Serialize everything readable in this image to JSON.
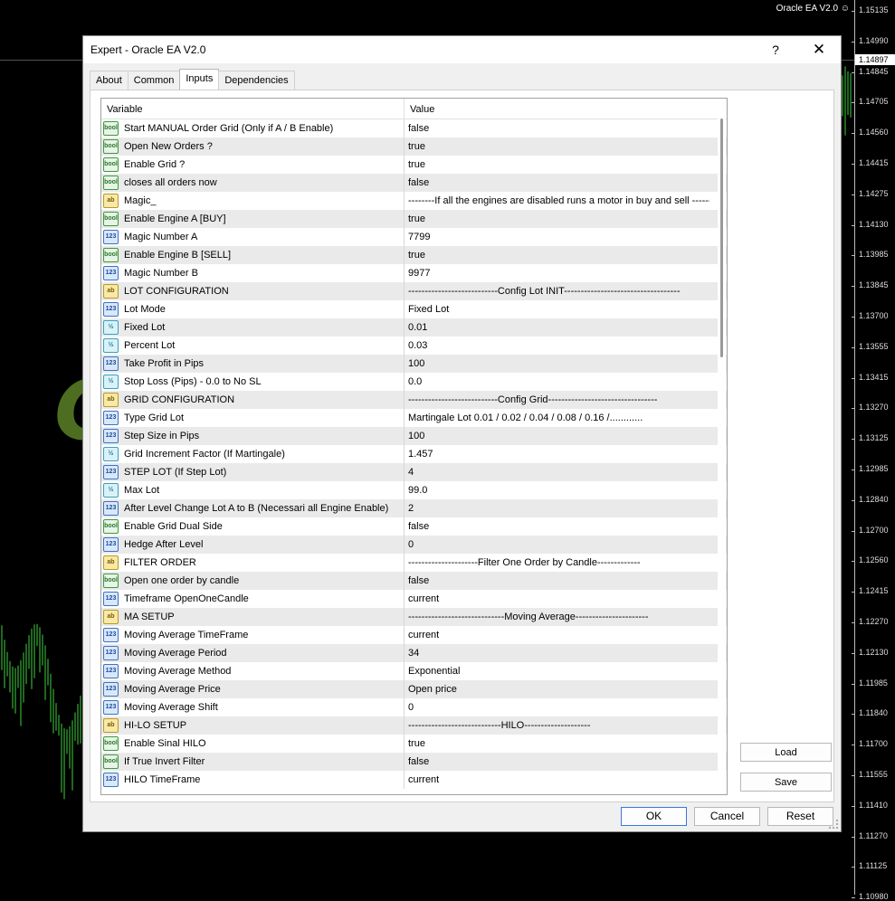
{
  "chart": {
    "ea_tag": "Oracle EA V2.0 ☺",
    "current_price": "1.14897",
    "price_levels": [
      "1.15135",
      "1.14990",
      "1.14845",
      "1.14705",
      "1.14560",
      "1.14415",
      "1.14275",
      "1.14130",
      "1.13985",
      "1.13845",
      "1.13700",
      "1.13555",
      "1.13415",
      "1.13270",
      "1.13125",
      "1.12985",
      "1.12840",
      "1.12700",
      "1.12560",
      "1.12415",
      "1.12270",
      "1.12130",
      "1.11985",
      "1.11840",
      "1.11700",
      "1.11555",
      "1.11410",
      "1.11270",
      "1.11125",
      "1.10980"
    ]
  },
  "dialog": {
    "title": "Expert - Oracle EA V2.0",
    "help": "?",
    "close": "✕",
    "tabs": [
      "About",
      "Common",
      "Inputs",
      "Dependencies"
    ],
    "active_tab": "Inputs",
    "columns": {
      "variable": "Variable",
      "value": "Value"
    },
    "rows": [
      {
        "type": "bool",
        "icon_label": "bool",
        "variable": "Start MANUAL Order  Grid  (Only if A / B Enable)",
        "value": "false"
      },
      {
        "type": "bool",
        "icon_label": "bool",
        "variable": "Open New Orders ?",
        "value": "true"
      },
      {
        "type": "bool",
        "icon_label": "bool",
        "variable": "Enable Grid ?",
        "value": "true"
      },
      {
        "type": "bool",
        "icon_label": "bool",
        "variable": "closes all orders now",
        "value": "false"
      },
      {
        "type": "str",
        "icon_label": "ab",
        "variable": "Magic_",
        "value": "--------If all the engines are disabled runs a motor in buy and sell ---------"
      },
      {
        "type": "bool",
        "icon_label": "bool",
        "variable": "Enable Engine A   [BUY]",
        "value": "true"
      },
      {
        "type": "int",
        "icon_label": "123",
        "variable": "Magic Number  A",
        "value": "7799"
      },
      {
        "type": "bool",
        "icon_label": "bool",
        "variable": "Enable Engine B   [SELL]",
        "value": "true"
      },
      {
        "type": "int",
        "icon_label": "123",
        "variable": "Magic Number  B",
        "value": "9977"
      },
      {
        "type": "str",
        "icon_label": "ab",
        "variable": "LOT CONFIGURATION",
        "value": "---------------------------Config Lot INIT-----------------------------------"
      },
      {
        "type": "int",
        "icon_label": "123",
        "variable": "Lot Mode",
        "value": "Fixed Lot"
      },
      {
        "type": "dbl",
        "icon_label": "½",
        "variable": "Fixed Lot",
        "value": "0.01"
      },
      {
        "type": "dbl",
        "icon_label": "½",
        "variable": "Percent Lot",
        "value": "0.03"
      },
      {
        "type": "int",
        "icon_label": "123",
        "variable": "Take Profit in Pips",
        "value": "100"
      },
      {
        "type": "dbl",
        "icon_label": "½",
        "variable": "Stop Loss (Pips) - 0.0 to No SL",
        "value": "0.0"
      },
      {
        "type": "str",
        "icon_label": "ab",
        "variable": "GRID CONFIGURATION",
        "value": "---------------------------Config Grid---------------------------------"
      },
      {
        "type": "int",
        "icon_label": "123",
        "variable": "Type Grid Lot",
        "value": "Martingale Lot  0.01 / 0.02 / 0.04 / 0.08 / 0.16 /............"
      },
      {
        "type": "int",
        "icon_label": "123",
        "variable": "Step Size in Pips",
        "value": "100"
      },
      {
        "type": "dbl",
        "icon_label": "½",
        "variable": "Grid Increment Factor (If Martingale)",
        "value": "1.457"
      },
      {
        "type": "int",
        "icon_label": "123",
        "variable": "STEP LOT (If  Step Lot)",
        "value": "4"
      },
      {
        "type": "dbl",
        "icon_label": "½",
        "variable": "Max Lot",
        "value": "99.0"
      },
      {
        "type": "int",
        "icon_label": "123",
        "variable": "After Level Change Lot A to B (Necessari all Engine Enable)",
        "value": "2"
      },
      {
        "type": "bool",
        "icon_label": "bool",
        "variable": "Enable Grid Dual Side",
        "value": "false"
      },
      {
        "type": "int",
        "icon_label": "123",
        "variable": "Hedge After Level",
        "value": "0"
      },
      {
        "type": "str",
        "icon_label": "ab",
        "variable": "FILTER ORDER",
        "value": "---------------------Filter One Order by Candle-------------"
      },
      {
        "type": "bool",
        "icon_label": "bool",
        "variable": "Open one order by candle",
        "value": "false"
      },
      {
        "type": "int",
        "icon_label": "123",
        "variable": "Timeframe OpenOneCandle",
        "value": "current"
      },
      {
        "type": "str",
        "icon_label": "ab",
        "variable": "MA SETUP",
        "value": "-----------------------------Moving Average----------------------"
      },
      {
        "type": "int",
        "icon_label": "123",
        "variable": "Moving Average TimeFrame",
        "value": "current"
      },
      {
        "type": "int",
        "icon_label": "123",
        "variable": "Moving Average Period",
        "value": "34"
      },
      {
        "type": "int",
        "icon_label": "123",
        "variable": "Moving Average Method",
        "value": "Exponential"
      },
      {
        "type": "int",
        "icon_label": "123",
        "variable": "Moving Average Price",
        "value": "Open price"
      },
      {
        "type": "int",
        "icon_label": "123",
        "variable": "Moving Average Shift",
        "value": "0"
      },
      {
        "type": "str",
        "icon_label": "ab",
        "variable": "HI-LO SETUP",
        "value": "----------------------------HILO--------------------"
      },
      {
        "type": "bool",
        "icon_label": "bool",
        "variable": "Enable Sinal  HILO",
        "value": "true"
      },
      {
        "type": "bool",
        "icon_label": "bool",
        "variable": "If True Invert Filter",
        "value": "false"
      },
      {
        "type": "int",
        "icon_label": "123",
        "variable": "HILO TimeFrame",
        "value": "current"
      }
    ],
    "side_buttons": {
      "load": "Load",
      "save": "Save"
    },
    "bottom_buttons": {
      "ok": "OK",
      "cancel": "Cancel",
      "reset": "Reset"
    }
  },
  "watermark": "CheapForexEa"
}
